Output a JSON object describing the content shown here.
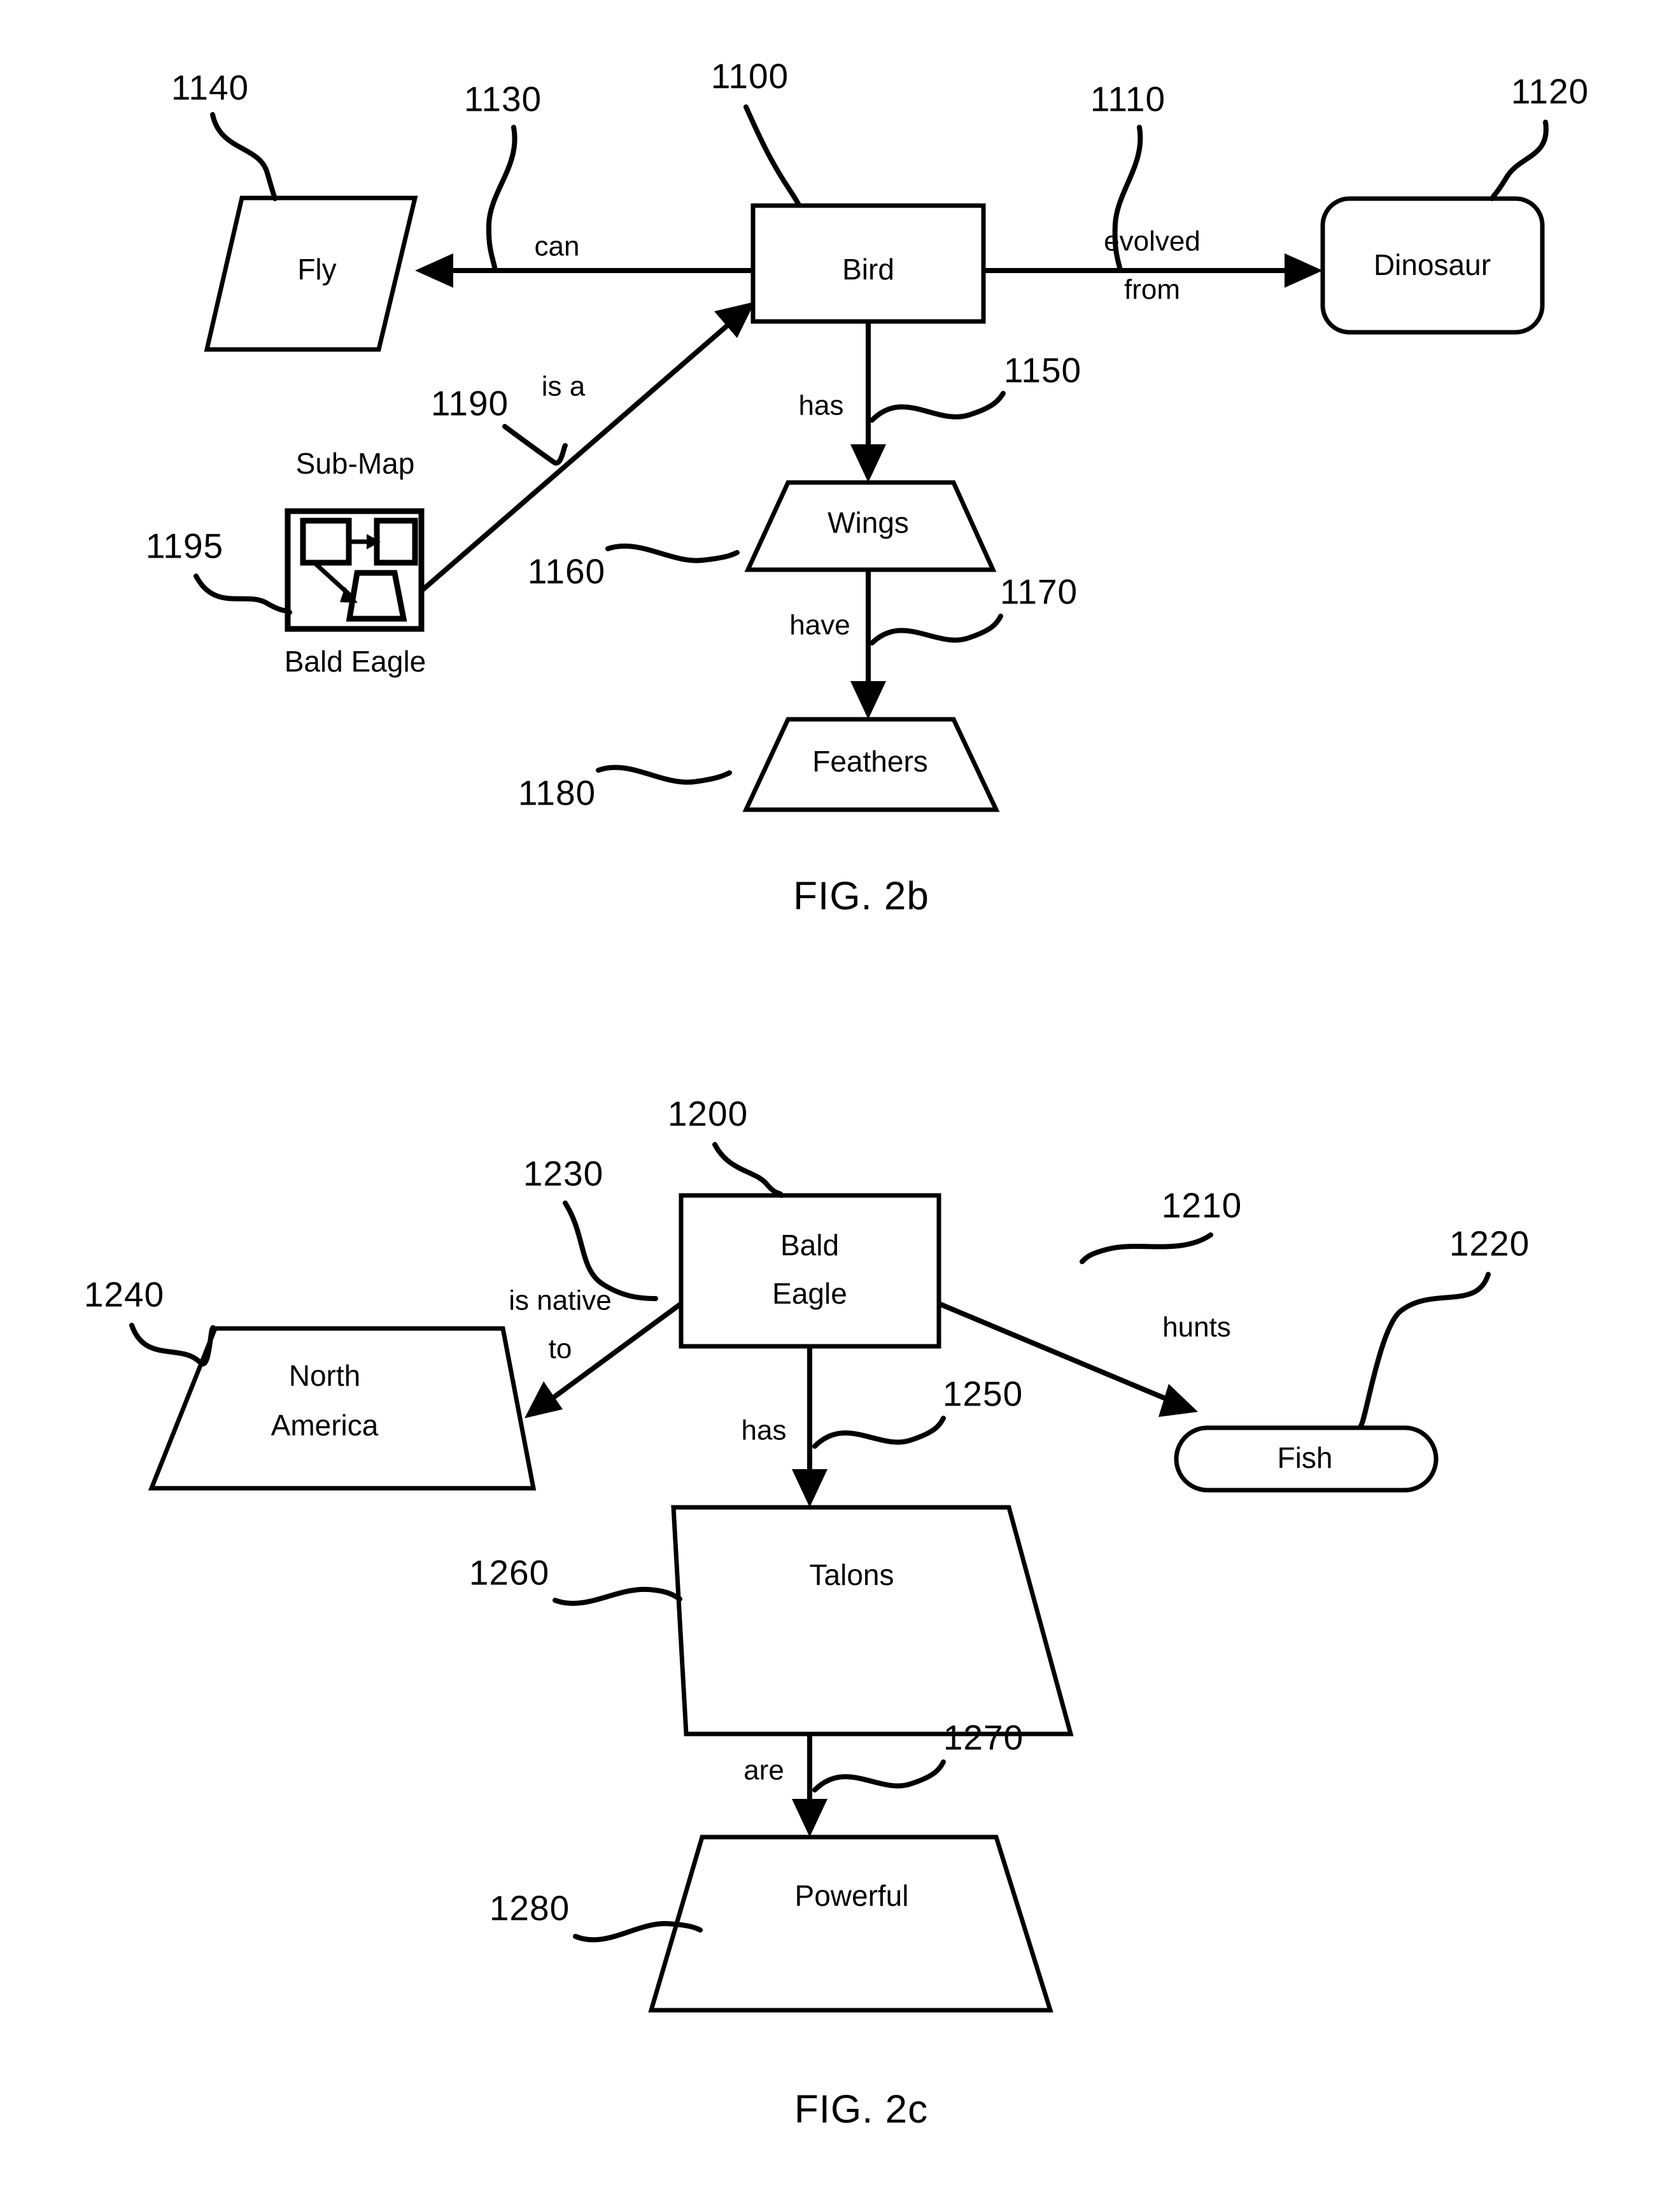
{
  "document": {
    "type": "patent-figure-sheet",
    "figures": [
      {
        "id": "fig-2b",
        "caption": "FIG. 2b",
        "nodes": [
          {
            "id": "bird",
            "label": "Bird",
            "shape": "rectangle",
            "ref": "1100"
          },
          {
            "id": "dinosaur",
            "label": "Dinosaur",
            "shape": "rounded-rect",
            "ref": "1120"
          },
          {
            "id": "fly",
            "label": "Fly",
            "shape": "parallelogram",
            "ref": "1140"
          },
          {
            "id": "wings",
            "label": "Wings",
            "shape": "trapezoid",
            "ref": "1160"
          },
          {
            "id": "feathers",
            "label": "Feathers",
            "shape": "trapezoid",
            "ref": "1180"
          },
          {
            "id": "submap",
            "label": "Bald Eagle",
            "title": "Sub-Map",
            "shape": "sub-map-icon",
            "ref": "1195"
          }
        ],
        "edges": [
          {
            "id": "e-evolved",
            "from": "bird",
            "to": "dinosaur",
            "label": "evolved from",
            "label_line1": "evolved",
            "label_line2": "from",
            "ref": "1110"
          },
          {
            "id": "e-can",
            "from": "bird",
            "to": "fly",
            "label": "can",
            "ref": "1130"
          },
          {
            "id": "e-has",
            "from": "bird",
            "to": "wings",
            "label": "has",
            "ref": "1150"
          },
          {
            "id": "e-have",
            "from": "wings",
            "to": "feathers",
            "label": "have",
            "ref": "1170"
          },
          {
            "id": "e-isa",
            "from": "submap",
            "to": "bird",
            "label": "is a",
            "ref": "1190"
          }
        ]
      },
      {
        "id": "fig-2c",
        "caption": "FIG. 2c",
        "nodes": [
          {
            "id": "baldeagle",
            "label": "Bald Eagle",
            "label_line1": "Bald",
            "label_line2": "Eagle",
            "shape": "rectangle",
            "ref": "1200"
          },
          {
            "id": "fish",
            "label": "Fish",
            "shape": "stadium",
            "ref": "1220"
          },
          {
            "id": "northamerica",
            "label": "North America",
            "label_line1": "North",
            "label_line2": "America",
            "shape": "trapezoid",
            "ref": "1240"
          },
          {
            "id": "talons",
            "label": "Talons",
            "shape": "trapezoid",
            "ref": "1260"
          },
          {
            "id": "powerful",
            "label": "Powerful",
            "shape": "trapezoid",
            "ref": "1280"
          }
        ],
        "edges": [
          {
            "id": "e-hunts",
            "from": "baldeagle",
            "to": "fish",
            "label": "hunts",
            "ref": "1210"
          },
          {
            "id": "e-native",
            "from": "baldeagle",
            "to": "northamerica",
            "label": "is native to",
            "label_line1": "is native",
            "label_line2": "to",
            "ref": "1230"
          },
          {
            "id": "e-has2",
            "from": "baldeagle",
            "to": "talons",
            "label": "has",
            "ref": "1250"
          },
          {
            "id": "e-are",
            "from": "talons",
            "to": "powerful",
            "label": "are",
            "ref": "1270"
          }
        ]
      }
    ]
  },
  "colors": {
    "ink": "#000000",
    "paper": "#ffffff"
  }
}
